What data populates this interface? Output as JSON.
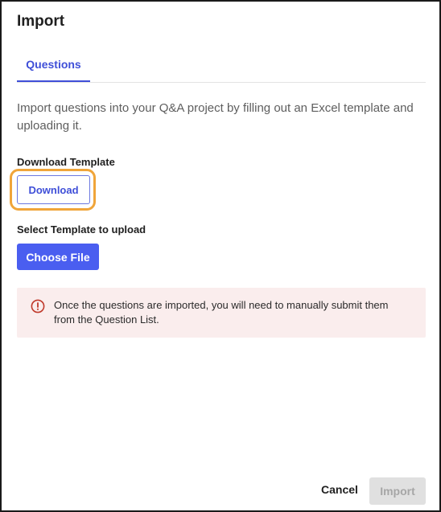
{
  "dialog": {
    "title": "Import"
  },
  "tabs": [
    {
      "label": "Questions",
      "active": true
    }
  ],
  "description": "Import questions into your Q&A project by filling out an Excel template and uploading it.",
  "download_section": {
    "label": "Download Template",
    "button_label": "Download",
    "highlight_color": "#f0a53a"
  },
  "upload_section": {
    "label": "Select Template to upload",
    "button_label": "Choose File"
  },
  "alert": {
    "icon": "error-circle-icon",
    "message": "Once the questions are imported, you will need to manually submit them from the Question List.",
    "color": "#c0392b",
    "background": "#faeded"
  },
  "footer": {
    "cancel_label": "Cancel",
    "import_label": "Import",
    "import_disabled": true
  },
  "colors": {
    "accent": "#3f4fd8",
    "primary_button": "#4a5ef0"
  }
}
